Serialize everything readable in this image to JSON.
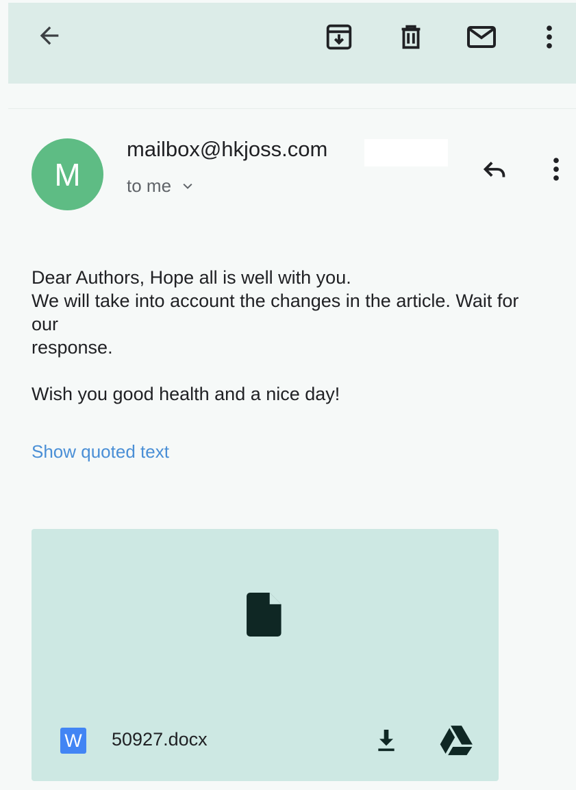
{
  "toolbar": {
    "icons": {
      "back": "arrow-back-icon",
      "archive": "archive-icon",
      "delete": "trash-icon",
      "unread": "mail-icon",
      "more": "more-vertical-icon"
    }
  },
  "message": {
    "avatar_letter": "M",
    "sender": "mailbox@hkjoss.com",
    "recipient_label": "to me",
    "body_lines": [
      "Dear Authors, Hope all is well with you.",
      "We will take into account the changes in the article. Wait for our",
      "response."
    ],
    "closing": "Wish you good health and a nice day!",
    "show_quoted": "Show quoted text"
  },
  "attachment": {
    "type_badge": "W",
    "filename": "50927.docx",
    "icons": {
      "preview": "file-icon",
      "download": "download-icon",
      "drive": "google-drive-icon"
    }
  },
  "colors": {
    "toolbar_bg": "#dcece8",
    "page_bg": "#f6f9f8",
    "avatar": "#5ebc84",
    "link": "#4a8fd6",
    "attachment_bg": "#cde8e3",
    "word_badge": "#4285f4"
  }
}
